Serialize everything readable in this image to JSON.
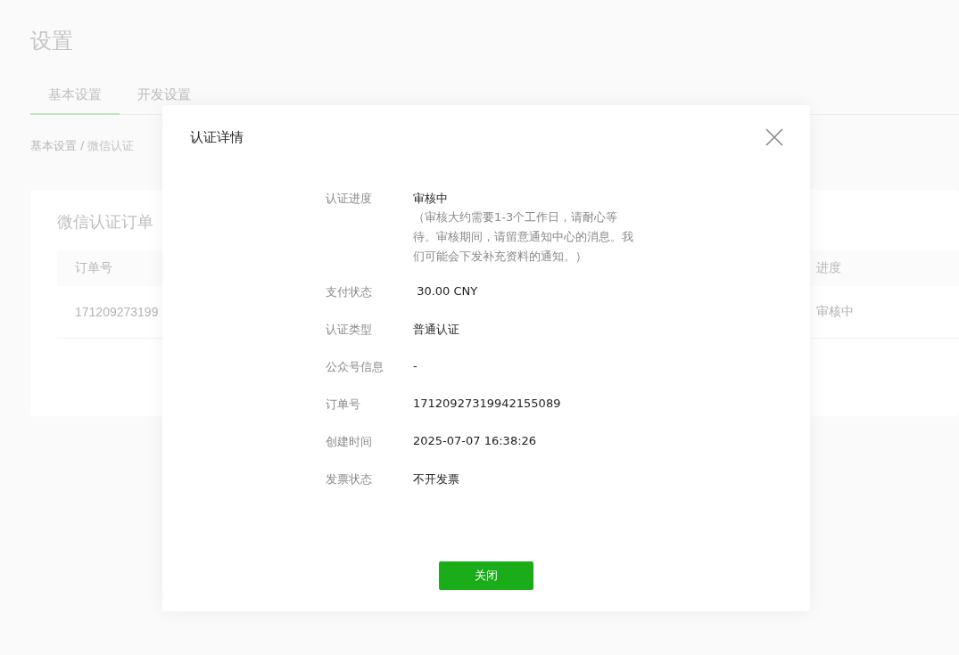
{
  "page": {
    "title": "设置"
  },
  "tabs": [
    {
      "label": "基本设置",
      "selected": true
    },
    {
      "label": "开发设置",
      "selected": false
    }
  ],
  "breadcrumb": {
    "parent": "基本设置",
    "separator": "/",
    "current": "微信认证"
  },
  "order_card": {
    "title": "微信认证订单",
    "columns": [
      "订单号",
      "进度"
    ],
    "rows": [
      [
        "171209273199",
        "审核中"
      ]
    ]
  },
  "dialog": {
    "title": "认证详情",
    "fields": [
      {
        "label": "认证进度",
        "value": "审核中",
        "note": "（审核大约需要1-3个工作日，请耐心等待。审核期间，请留意通知中心的消息。我们可能会下发补充资料的通知。）"
      },
      {
        "label": "支付状态",
        "value": " 30.00 CNY"
      },
      {
        "label": "认证类型",
        "value": "普通认证"
      },
      {
        "label": "公众号信息",
        "value": "-"
      },
      {
        "label": "订单号",
        "value": "17120927319942155089"
      },
      {
        "label": "创建时间",
        "value": "2025-07-07 16:38:26"
      },
      {
        "label": "发票状态",
        "value": "不开发票"
      }
    ],
    "button": "关闭"
  }
}
